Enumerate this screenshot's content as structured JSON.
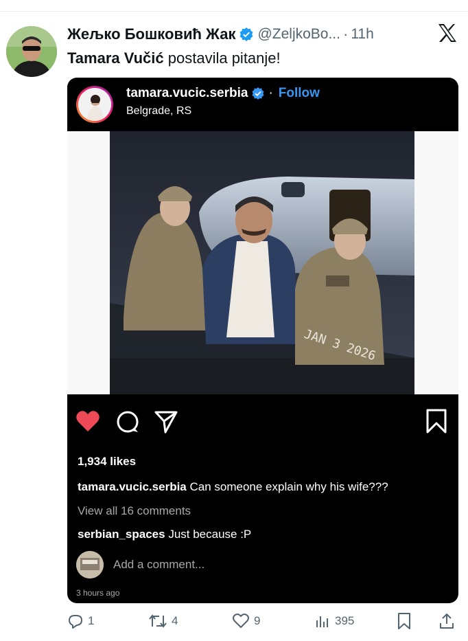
{
  "tweet": {
    "author_name": "Жељко Бошковић Жак",
    "handle": "@ZeljkoBo...",
    "separator": "·",
    "time": "11h",
    "text_bold": "Tamara Vučić",
    "text_rest": " postavila pitanje!",
    "verified_color": "#1d9bf0"
  },
  "instagram": {
    "username": "tamara.vucic.serbia",
    "separator": "·",
    "follow_label": "Follow",
    "location": "Belgrade, RS",
    "photo_overlay_text": "JAN 3 2026",
    "likes": "1,934 likes",
    "caption_user": "tamara.vucic.serbia",
    "caption_text": " Can someone explain why his wife???",
    "view_all": "View all 16 comments",
    "comment_user": "serbian_spaces",
    "comment_text": " Just because :P",
    "add_comment_placeholder": "Add a comment...",
    "posted_ago": "3 hours ago",
    "like_color": "#ed4956",
    "follow_color": "#3897f0"
  },
  "footer": {
    "replies": "1",
    "reposts": "4",
    "likes": "9",
    "views": "395"
  }
}
